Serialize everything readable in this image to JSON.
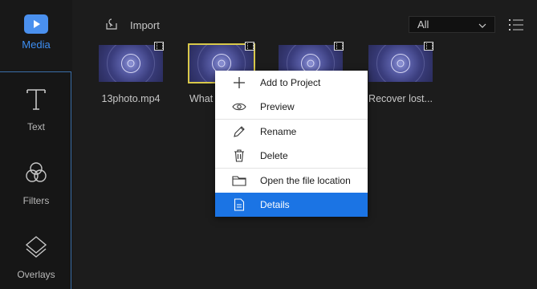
{
  "sidebar": {
    "items": [
      {
        "label": "Media",
        "icon": "media-play-icon",
        "active": true
      },
      {
        "label": "Text",
        "icon": "text-icon"
      },
      {
        "label": "Filters",
        "icon": "filters-icon"
      },
      {
        "label": "Overlays",
        "icon": "overlays-icon"
      }
    ]
  },
  "toolbar": {
    "import_label": "Import",
    "filter_value": "All",
    "list_view_icon": "list-view-icon"
  },
  "media": {
    "items": [
      {
        "label": "13photo.mp4",
        "selected": false
      },
      {
        "label": "What",
        "selected": true
      },
      {
        "label": "",
        "selected": false
      },
      {
        "label": "Recover lost...",
        "selected": false
      }
    ]
  },
  "context_menu": {
    "items": [
      {
        "label": "Add to Project",
        "icon": "plus-icon"
      },
      {
        "label": "Preview",
        "icon": "eye-icon"
      },
      {
        "label": "Rename",
        "icon": "pencil-icon"
      },
      {
        "label": "Delete",
        "icon": "trash-icon"
      },
      {
        "label": "Open the file location",
        "icon": "folder-icon"
      },
      {
        "label": "Details",
        "icon": "document-icon",
        "highlighted": true
      }
    ]
  },
  "colors": {
    "accent": "#1b74e4",
    "media_active": "#3d8ef2",
    "selection_outline": "#d8c84a"
  }
}
